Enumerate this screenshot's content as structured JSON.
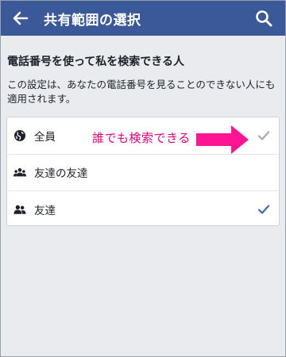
{
  "header": {
    "title": "共有範囲の選択",
    "back_icon": "arrow-left-icon",
    "search_icon": "search-icon",
    "bg_color": "#3b5998"
  },
  "section": {
    "title": "電話番号を使って私を検索できる人",
    "description": "この設定は、あなたの電話番号を見ることのできない人にも適用されます。"
  },
  "options": [
    {
      "label": "全員",
      "icon": "globe-icon",
      "check": "gray"
    },
    {
      "label": "友達の友達",
      "icon": "friends-of-friends-icon",
      "check": "none"
    },
    {
      "label": "友達",
      "icon": "friends-icon",
      "check": "blue"
    }
  ],
  "annotation": {
    "text": "誰でも検索できる",
    "color": "#e6007e"
  }
}
